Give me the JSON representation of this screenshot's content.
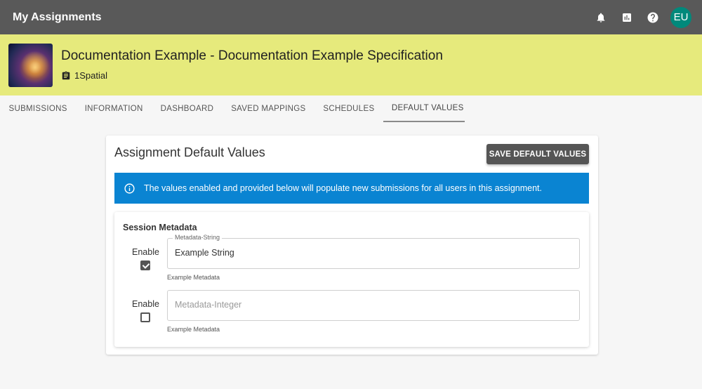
{
  "appbar": {
    "title": "My Assignments",
    "icons": [
      "bell-icon",
      "bar-chart-icon",
      "help-icon"
    ],
    "avatar": "EU",
    "avatar_color": "#00897b"
  },
  "banner": {
    "title": "Documentation Example - Documentation Example Specification",
    "org": "1Spatial",
    "background": "#e6ea7c"
  },
  "tabs": [
    "SUBMISSIONS",
    "INFORMATION",
    "DASHBOARD",
    "SAVED MAPPINGS",
    "SCHEDULES",
    "DEFAULT VALUES"
  ],
  "active_tab": "DEFAULT VALUES",
  "card": {
    "title": "Assignment Default Values",
    "save_label": "SAVE DEFAULT VALUES",
    "info_text": "The values enabled and provided below will populate new submissions for all users in this assignment.",
    "info_color": "#0a84d2"
  },
  "metadata": {
    "title": "Session Metadata",
    "fields": [
      {
        "enable_label": "Enable",
        "checked": true,
        "legend": "Metadata-String",
        "value": "Example String",
        "placeholder": "",
        "helper": "Example Metadata"
      },
      {
        "enable_label": "Enable",
        "checked": false,
        "legend": "",
        "value": "",
        "placeholder": "Metadata-Integer",
        "helper": "Example Metadata"
      }
    ]
  }
}
